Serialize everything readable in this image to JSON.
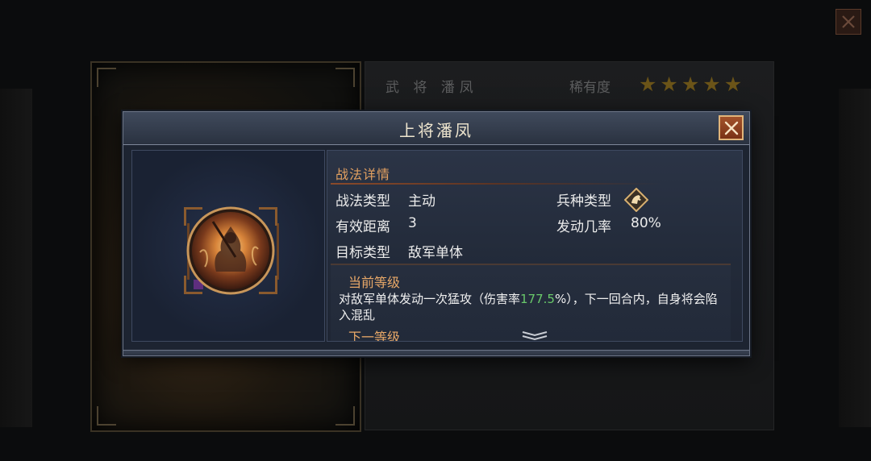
{
  "background": {
    "title": "武 将 潘凤",
    "rarity_label": "稀有度",
    "stars": 5
  },
  "modal": {
    "title": "上将潘凤",
    "section_heading": "战法详情",
    "stats": {
      "tactic_type_label": "战法类型",
      "tactic_type_value": "主动",
      "range_label": "有效距离",
      "range_value": "3",
      "target_label": "目标类型",
      "target_value": "敌军单体",
      "unit_type_label": "兵种类型",
      "unit_type_icon": "cavalry-icon",
      "trigger_rate_label": "发动几率",
      "trigger_rate_value": "80%"
    },
    "current_level": {
      "title": "当前等级",
      "desc_before": "对敌军单体发动一次猛攻（伤害率",
      "damage_rate": "177.5",
      "desc_after": "%），下一回合内，自身将会陷入混乱"
    },
    "next_level_title": "下一等级"
  },
  "icons": {
    "skill": "flame-warrior-icon",
    "close": "close-icon",
    "expand": "chevron-down-icon"
  },
  "colors": {
    "accent_orange": "#e2a060",
    "highlight_green": "#69c86a",
    "star_gold": "#6b5418"
  }
}
